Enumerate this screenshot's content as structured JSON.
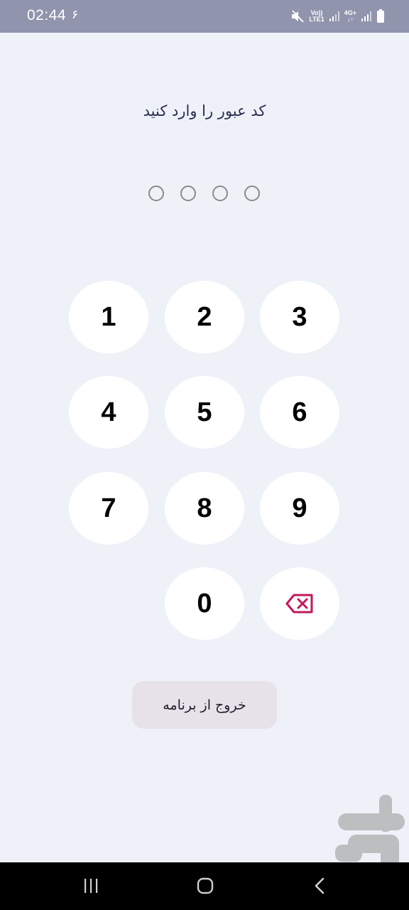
{
  "status_bar": {
    "time": "02:44",
    "notification_badge": "۶",
    "volte_line1": "Vo))",
    "volte_line2": "LTE1",
    "network_type": "4G+",
    "icons": [
      "mute-icon",
      "volte-icon",
      "signal-icon",
      "data-arrows-icon",
      "signal-icon",
      "battery-icon"
    ]
  },
  "title": "کد عبور را وارد کنید",
  "pin": {
    "length": 4,
    "filled": 0
  },
  "keypad": {
    "k1": "1",
    "k2": "2",
    "k3": "3",
    "k4": "4",
    "k5": "5",
    "k6": "6",
    "k7": "7",
    "k8": "8",
    "k9": "9",
    "k0": "0",
    "backspace_icon": "backspace-icon",
    "accent_color": "#c2185b"
  },
  "exit_button": {
    "label": "خروج از برنامه"
  },
  "watermark": {
    "icon": "app-store-logo"
  },
  "nav_bar": {
    "icons": [
      "recent-apps-icon",
      "home-icon",
      "back-icon"
    ]
  }
}
